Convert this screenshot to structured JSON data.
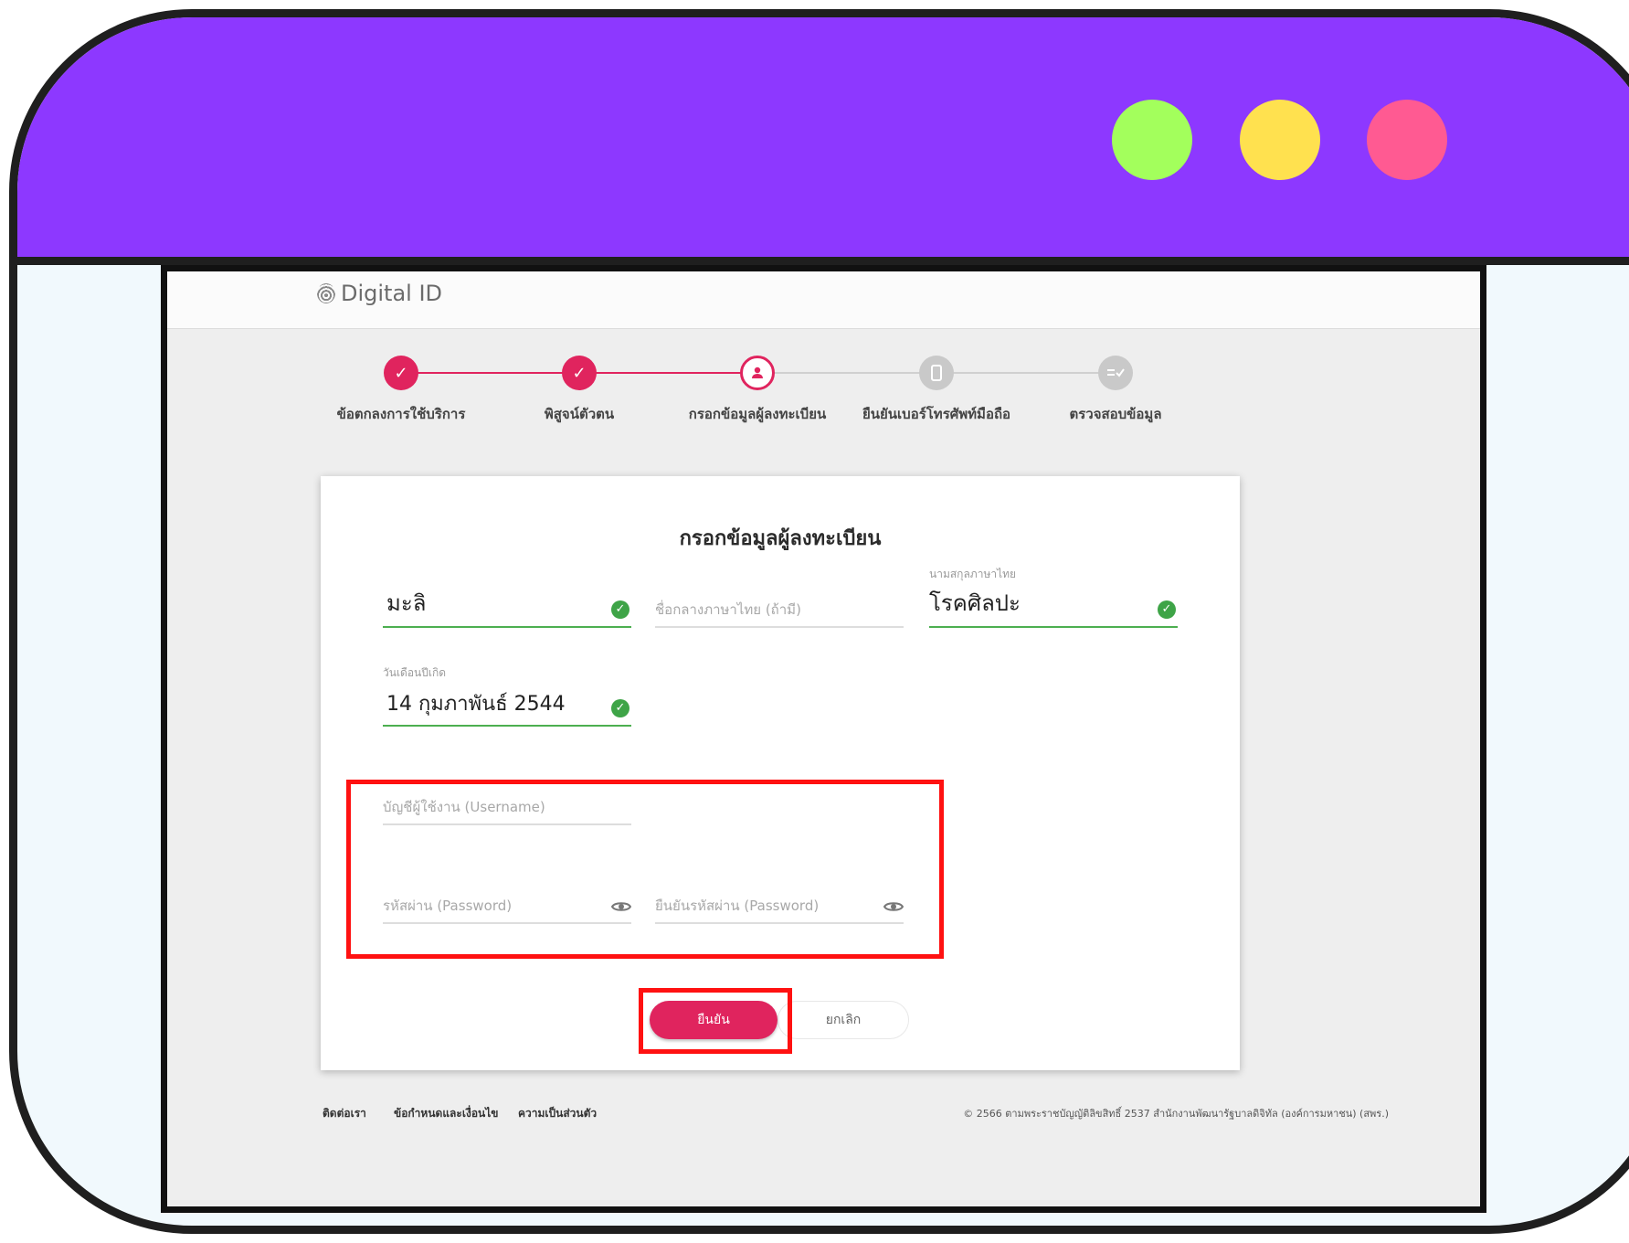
{
  "window": {
    "colors": {
      "titlebar": "#8d38ff",
      "dot_green": "#a3ff5c",
      "dot_yellow": "#ffe14f",
      "dot_red": "#ff5a92"
    }
  },
  "app": {
    "logo_text": "Digital ID"
  },
  "stepper": {
    "steps": [
      {
        "label": "ข้อตกลงการใช้บริการ",
        "state": "done",
        "icon": "check-icon"
      },
      {
        "label": "พิสูจน์ตัวตน",
        "state": "done",
        "icon": "check-icon"
      },
      {
        "label": "กรอกข้อมูลผู้ลงทะเบียน",
        "state": "active",
        "icon": "user-icon"
      },
      {
        "label": "ยืนยันเบอร์โทรศัพท์มือถือ",
        "state": "todo",
        "icon": "phone-icon"
      },
      {
        "label": "ตรวจสอบข้อมูล",
        "state": "todo",
        "icon": "checklist-icon"
      }
    ]
  },
  "form": {
    "title": "กรอกข้อมูลผู้ลงทะเบียน",
    "first_name": {
      "value": "มะลิ"
    },
    "middle_name": {
      "placeholder": "ชื่อกลางภาษาไทย (ถ้ามี)"
    },
    "last_name": {
      "label": "นามสกุลภาษาไทย",
      "value": "โรคศิลปะ"
    },
    "birth_date": {
      "label": "วันเดือนปีเกิด",
      "value": "14 กุมภาพันธ์ 2544"
    },
    "username": {
      "placeholder": "บัญชีผู้ใช้งาน (Username)"
    },
    "password": {
      "placeholder": "รหัสผ่าน (Password)"
    },
    "confirm_password": {
      "placeholder": "ยืนยันรหัสผ่าน (Password)"
    },
    "confirm_button": "ยืนยัน",
    "cancel_button": "ยกเลิก"
  },
  "footer": {
    "contact": "ติดต่อเรา",
    "terms": "ข้อกำหนดและเงื่อนไข",
    "privacy": "ความเป็นส่วนตัว",
    "copyright": "© 2566 ตามพระราชบัญญัติลิขสิทธิ์ 2537 สำนักงานพัฒนารัฐบาลดิจิทัล (องค์การมหาชน) (สพร.)"
  },
  "theme": {
    "accent": "#e0245e",
    "success": "#4caf50",
    "highlight": "#ff1111"
  }
}
